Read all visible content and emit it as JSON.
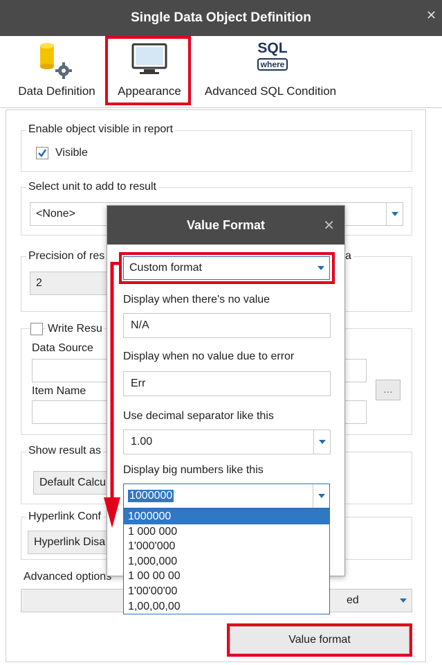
{
  "window": {
    "title": "Single Data Object Definition"
  },
  "tabs": [
    {
      "label": "Data Definition",
      "icon": "database-gear-icon"
    },
    {
      "label": "Appearance",
      "icon": "monitor-icon"
    },
    {
      "label": "Advanced SQL Condition",
      "icon": "sql-where-icon",
      "icon_text_top": "SQL",
      "icon_text_bottom": "where"
    }
  ],
  "visible_group": {
    "legend": "Enable object visible in report",
    "checkbox_label": "Visible",
    "checked": true
  },
  "unit_group": {
    "legend": "Select unit to add to result",
    "value": "<None>"
  },
  "precision_group": {
    "legend_left": "Precision of res",
    "legend_right": "a",
    "value": "2"
  },
  "write_group": {
    "checkbox_label": "Write Resu",
    "data_source_label": "Data Source",
    "item_name_label": "Item Name",
    "ellipsis": "..."
  },
  "show_group": {
    "legend": "Show result as",
    "value": "Default Calcu"
  },
  "hyperlink_group": {
    "legend": "Hyperlink Conf",
    "value": "Hyperlink Disa"
  },
  "advanced": {
    "label": "Advanced options",
    "value_suffix": "ed"
  },
  "value_format_button": "Value format",
  "modal": {
    "title": "Value Format",
    "format_select": "Custom format",
    "no_value_label": "Display when there's no value",
    "no_value": "N/A",
    "error_label": "Display when no value due to error",
    "error_value": "Err",
    "decimal_label": "Use decimal separator like this",
    "decimal_value": "1.00",
    "big_numbers_label": "Display big numbers like this",
    "big_numbers_value": "1000000",
    "big_numbers_options": [
      "1000000",
      "1 000 000",
      "1'000'000",
      "1,000,000",
      "1 00 00 00",
      "1'00'00'00",
      "1,00,00,00"
    ]
  },
  "colors": {
    "titlebar": "#4a4a4a",
    "highlight": "#e3001b",
    "selection": "#2f78c4",
    "accent": "#1f6fb5"
  }
}
